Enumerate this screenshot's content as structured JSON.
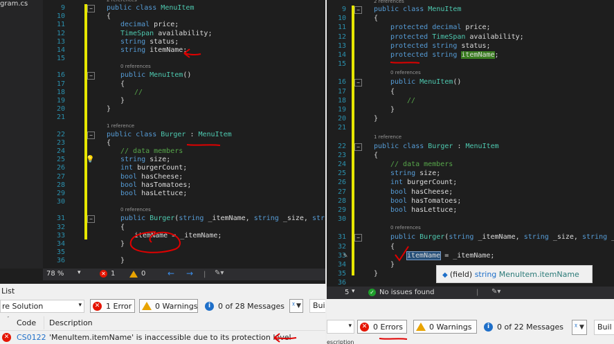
{
  "left": {
    "solution_item": "gram.cs",
    "codelens_top": "2 references",
    "codelens_ctor": "0 references",
    "codelens_burger": "1 reference",
    "codelens_burger_ctor": "0 references",
    "lines": [
      {
        "n": "9",
        "text": "public class MenuItem"
      },
      {
        "n": "10",
        "text": "{"
      },
      {
        "n": "11",
        "text": "decimal price;"
      },
      {
        "n": "12",
        "text": "TimeSpan availability;"
      },
      {
        "n": "13",
        "text": "string status;"
      },
      {
        "n": "14",
        "text": "string itemName;"
      },
      {
        "n": "15",
        "text": ""
      },
      {
        "n": "16",
        "text": "public MenuItem()"
      },
      {
        "n": "17",
        "text": "{"
      },
      {
        "n": "18",
        "text": "//"
      },
      {
        "n": "19",
        "text": "}"
      },
      {
        "n": "20",
        "text": "}"
      },
      {
        "n": "21",
        "text": ""
      },
      {
        "n": "22",
        "text": "public class Burger : MenuItem"
      },
      {
        "n": "23",
        "text": "{"
      },
      {
        "n": "24",
        "text": "// data members"
      },
      {
        "n": "25",
        "text": "string size;"
      },
      {
        "n": "26",
        "text": "int burgerCount;"
      },
      {
        "n": "27",
        "text": "bool hasCheese;"
      },
      {
        "n": "28",
        "text": "bool hasTomatoes;"
      },
      {
        "n": "29",
        "text": "bool hasLettuce;"
      },
      {
        "n": "30",
        "text": ""
      },
      {
        "n": "31",
        "text": "public Burger(string _itemName, string _size, string _bu"
      },
      {
        "n": "32",
        "text": "{"
      },
      {
        "n": "33",
        "text": "itemName = _itemName;"
      },
      {
        "n": "34",
        "text": "}"
      },
      {
        "n": "35",
        "text": ""
      },
      {
        "n": "36",
        "text": "}"
      }
    ],
    "status": {
      "zoom": "78 %",
      "errors": "1",
      "warnings": "0"
    },
    "error_list": {
      "title": "List",
      "scope": "re Solution",
      "errors_btn": "1 Error",
      "warnings_btn": "0 Warnings",
      "messages_btn": "0 of 28 Messages",
      "build_btn": "Buil",
      "col_code": "Code",
      "col_description": "Description",
      "row": {
        "code": "CS0122",
        "description": "'MenuItem.itemName' is inaccessible due to its protection level"
      }
    }
  },
  "right": {
    "codelens_top": "2 references",
    "codelens_ctor": "0 references",
    "codelens_burger": "1 reference",
    "codelens_burger_ctor": "0 references",
    "lines": [
      {
        "n": "9",
        "text": "public class MenuItem"
      },
      {
        "n": "10",
        "text": "{"
      },
      {
        "n": "11",
        "text": "protected decimal price;"
      },
      {
        "n": "12",
        "text": "protected TimeSpan availability;"
      },
      {
        "n": "13",
        "text": "protected string status;"
      },
      {
        "n": "14",
        "text": "protected string itemName;"
      },
      {
        "n": "15",
        "text": ""
      },
      {
        "n": "16",
        "text": "public MenuItem()"
      },
      {
        "n": "17",
        "text": "{"
      },
      {
        "n": "18",
        "text": "//"
      },
      {
        "n": "19",
        "text": "}"
      },
      {
        "n": "20",
        "text": "}"
      },
      {
        "n": "21",
        "text": ""
      },
      {
        "n": "22",
        "text": "public class Burger : MenuItem"
      },
      {
        "n": "23",
        "text": "{"
      },
      {
        "n": "24",
        "text": "// data members"
      },
      {
        "n": "25",
        "text": "string size;"
      },
      {
        "n": "26",
        "text": "int burgerCount;"
      },
      {
        "n": "27",
        "text": "bool hasCheese;"
      },
      {
        "n": "28",
        "text": "bool hasTomatoes;"
      },
      {
        "n": "29",
        "text": "bool hasLettuce;"
      },
      {
        "n": "30",
        "text": ""
      },
      {
        "n": "31",
        "text": "public Burger(string _itemName, string _size, string _bur"
      },
      {
        "n": "32",
        "text": "{"
      },
      {
        "n": "33",
        "text": "itemName = _itemName;"
      },
      {
        "n": "34",
        "text": "}"
      },
      {
        "n": "35",
        "text": "}"
      },
      {
        "n": "36",
        "text": ""
      }
    ],
    "tooltip": {
      "prefix": "(field) ",
      "type": "string ",
      "name": "MenuItem.itemName"
    },
    "status": {
      "zoom_fragment": "5",
      "issues": "No issues found"
    },
    "error_list": {
      "errors_btn": "0 Errors",
      "warnings_btn": "0 Warnings",
      "messages_btn": "0 of 22 Messages",
      "build_btn": "Buil",
      "bottom_fragment": "escription"
    }
  },
  "colors": {
    "keyword": "#569cd6",
    "type": "#4ec9b0",
    "comment": "#57a64a",
    "line_number": "#2b91af",
    "error_red": "#e51400",
    "annotation_red": "#e00000"
  }
}
